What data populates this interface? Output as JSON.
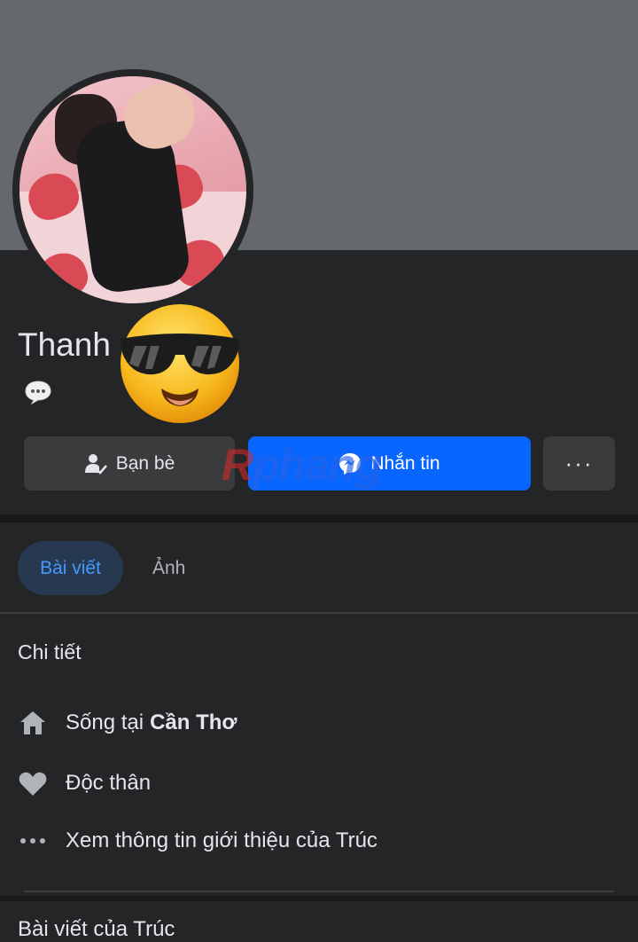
{
  "profile": {
    "name": "Thanh",
    "emoji": "sunglasses-face",
    "status_icon": "speech-bubble-icon"
  },
  "actions": {
    "friends_label": "Bạn bè",
    "message_label": "Nhắn tin",
    "more_label": "···"
  },
  "watermark": {
    "part1": "R",
    "part2": "phang"
  },
  "tabs": [
    {
      "label": "Bài viết",
      "active": true
    },
    {
      "label": "Ảnh",
      "active": false
    }
  ],
  "details": {
    "title": "Chi tiết",
    "lives_prefix": "Sống tại",
    "lives_place": "Cần Thơ",
    "relationship": "Độc thân",
    "see_more": "Xem thông tin giới thiệu của Trúc"
  },
  "posts": {
    "title": "Bài viết của Trúc"
  },
  "colors": {
    "background": "#242526",
    "cover": "#65686c",
    "accent": "#0866ff",
    "tab_active_text": "#4599ff"
  }
}
